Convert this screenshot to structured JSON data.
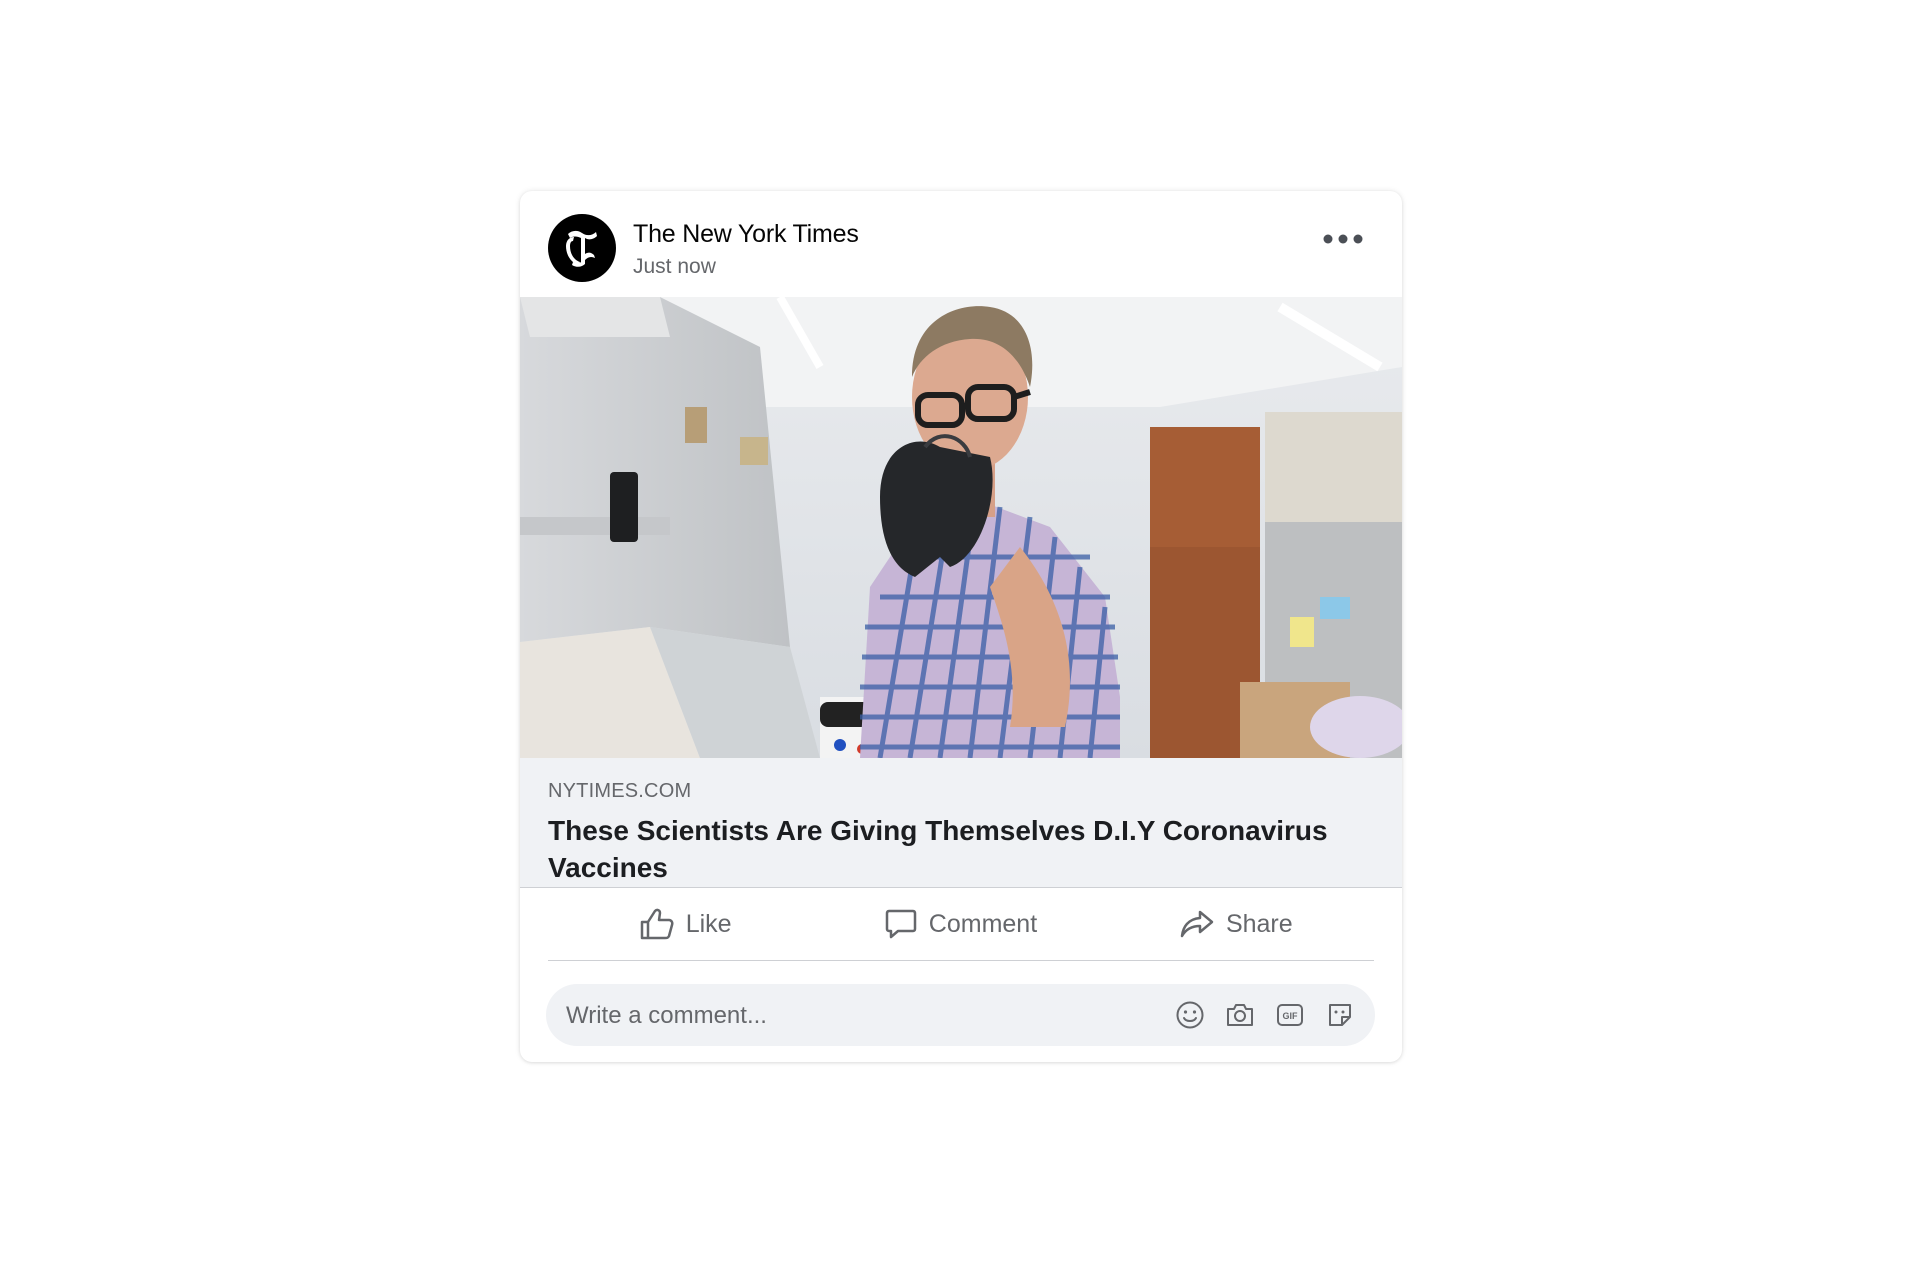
{
  "post": {
    "publisher": "The New York Times",
    "timestamp": "Just now",
    "avatar_icon": "nyt-logo-icon",
    "more_icon": "more-options-icon"
  },
  "image": {
    "description_icon": "article-photo"
  },
  "link": {
    "domain": "NYTIMES.COM",
    "title": "These Scientists Are Giving Themselves D.I.Y Coronavirus Vaccines"
  },
  "actions": {
    "like_label": "Like",
    "comment_label": "Comment",
    "share_label": "Share"
  },
  "comment": {
    "placeholder": "Write a comment...",
    "icons": [
      "emoji-icon",
      "camera-icon",
      "gif-icon",
      "sticker-icon"
    ]
  },
  "colors": {
    "text_primary": "#050505",
    "text_secondary": "#65676b",
    "surface": "#f0f2f5",
    "divider": "#ced0d4"
  }
}
